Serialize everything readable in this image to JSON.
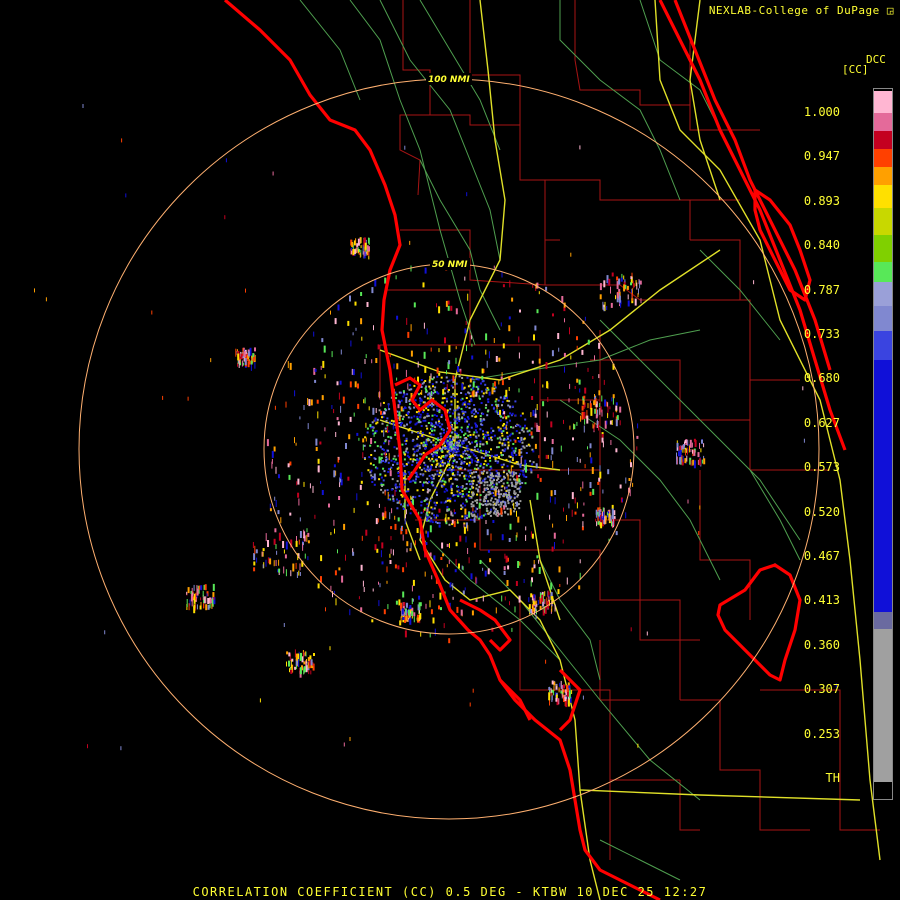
{
  "header": {
    "credit": "NEXLAB-College of DuPage ◲",
    "product_code": "DCC",
    "unit": "[CC]"
  },
  "footer": {
    "caption": "CORRELATION COEFFICIENT (CC) 0.5 DEG - KTBW 10 DEC 25 12:27"
  },
  "range_rings": [
    {
      "label": "100 NMI",
      "range_nmi": 100
    },
    {
      "label": "50 NMI",
      "range_nmi": 50
    }
  ],
  "color_scale": {
    "ticks": [
      "1.000",
      "0.947",
      "0.893",
      "0.840",
      "0.787",
      "0.733",
      "0.680",
      "0.627",
      "0.573",
      "0.520",
      "0.467",
      "0.413",
      "0.360",
      "0.307",
      "0.253",
      "TH"
    ],
    "segments": [
      {
        "from": 1.0,
        "to": 0.975,
        "color": "#ffb6d2"
      },
      {
        "from": 0.975,
        "to": 0.955,
        "color": "#e46a9a"
      },
      {
        "from": 0.955,
        "to": 0.935,
        "color": "#c40020"
      },
      {
        "from": 0.935,
        "to": 0.915,
        "color": "#ff4000"
      },
      {
        "from": 0.915,
        "to": 0.895,
        "color": "#ffa000"
      },
      {
        "from": 0.895,
        "to": 0.87,
        "color": "#ffe000"
      },
      {
        "from": 0.87,
        "to": 0.84,
        "color": "#c8d800"
      },
      {
        "from": 0.84,
        "to": 0.81,
        "color": "#80d000"
      },
      {
        "from": 0.81,
        "to": 0.787,
        "color": "#58e858"
      },
      {
        "from": 0.787,
        "to": 0.76,
        "color": "#9aa0d8"
      },
      {
        "from": 0.76,
        "to": 0.733,
        "color": "#8088d0"
      },
      {
        "from": 0.733,
        "to": 0.7,
        "color": "#3a44e0"
      },
      {
        "from": 0.7,
        "to": 0.42,
        "color": "#1010d8"
      },
      {
        "from": 0.42,
        "to": 0.4,
        "color": "#6a6aa0"
      },
      {
        "from": 0.4,
        "to": 0.23,
        "color": "#a0a0a0"
      },
      {
        "from": 0.23,
        "to": 0.22,
        "color": "#000000"
      }
    ]
  },
  "colors": {
    "coastline": "#ff0000",
    "county_lines": "#b01818",
    "highways": "#e8e830",
    "rivers": "#5fb35f",
    "range_ring": "#ffb070",
    "text": "#ffff33"
  }
}
